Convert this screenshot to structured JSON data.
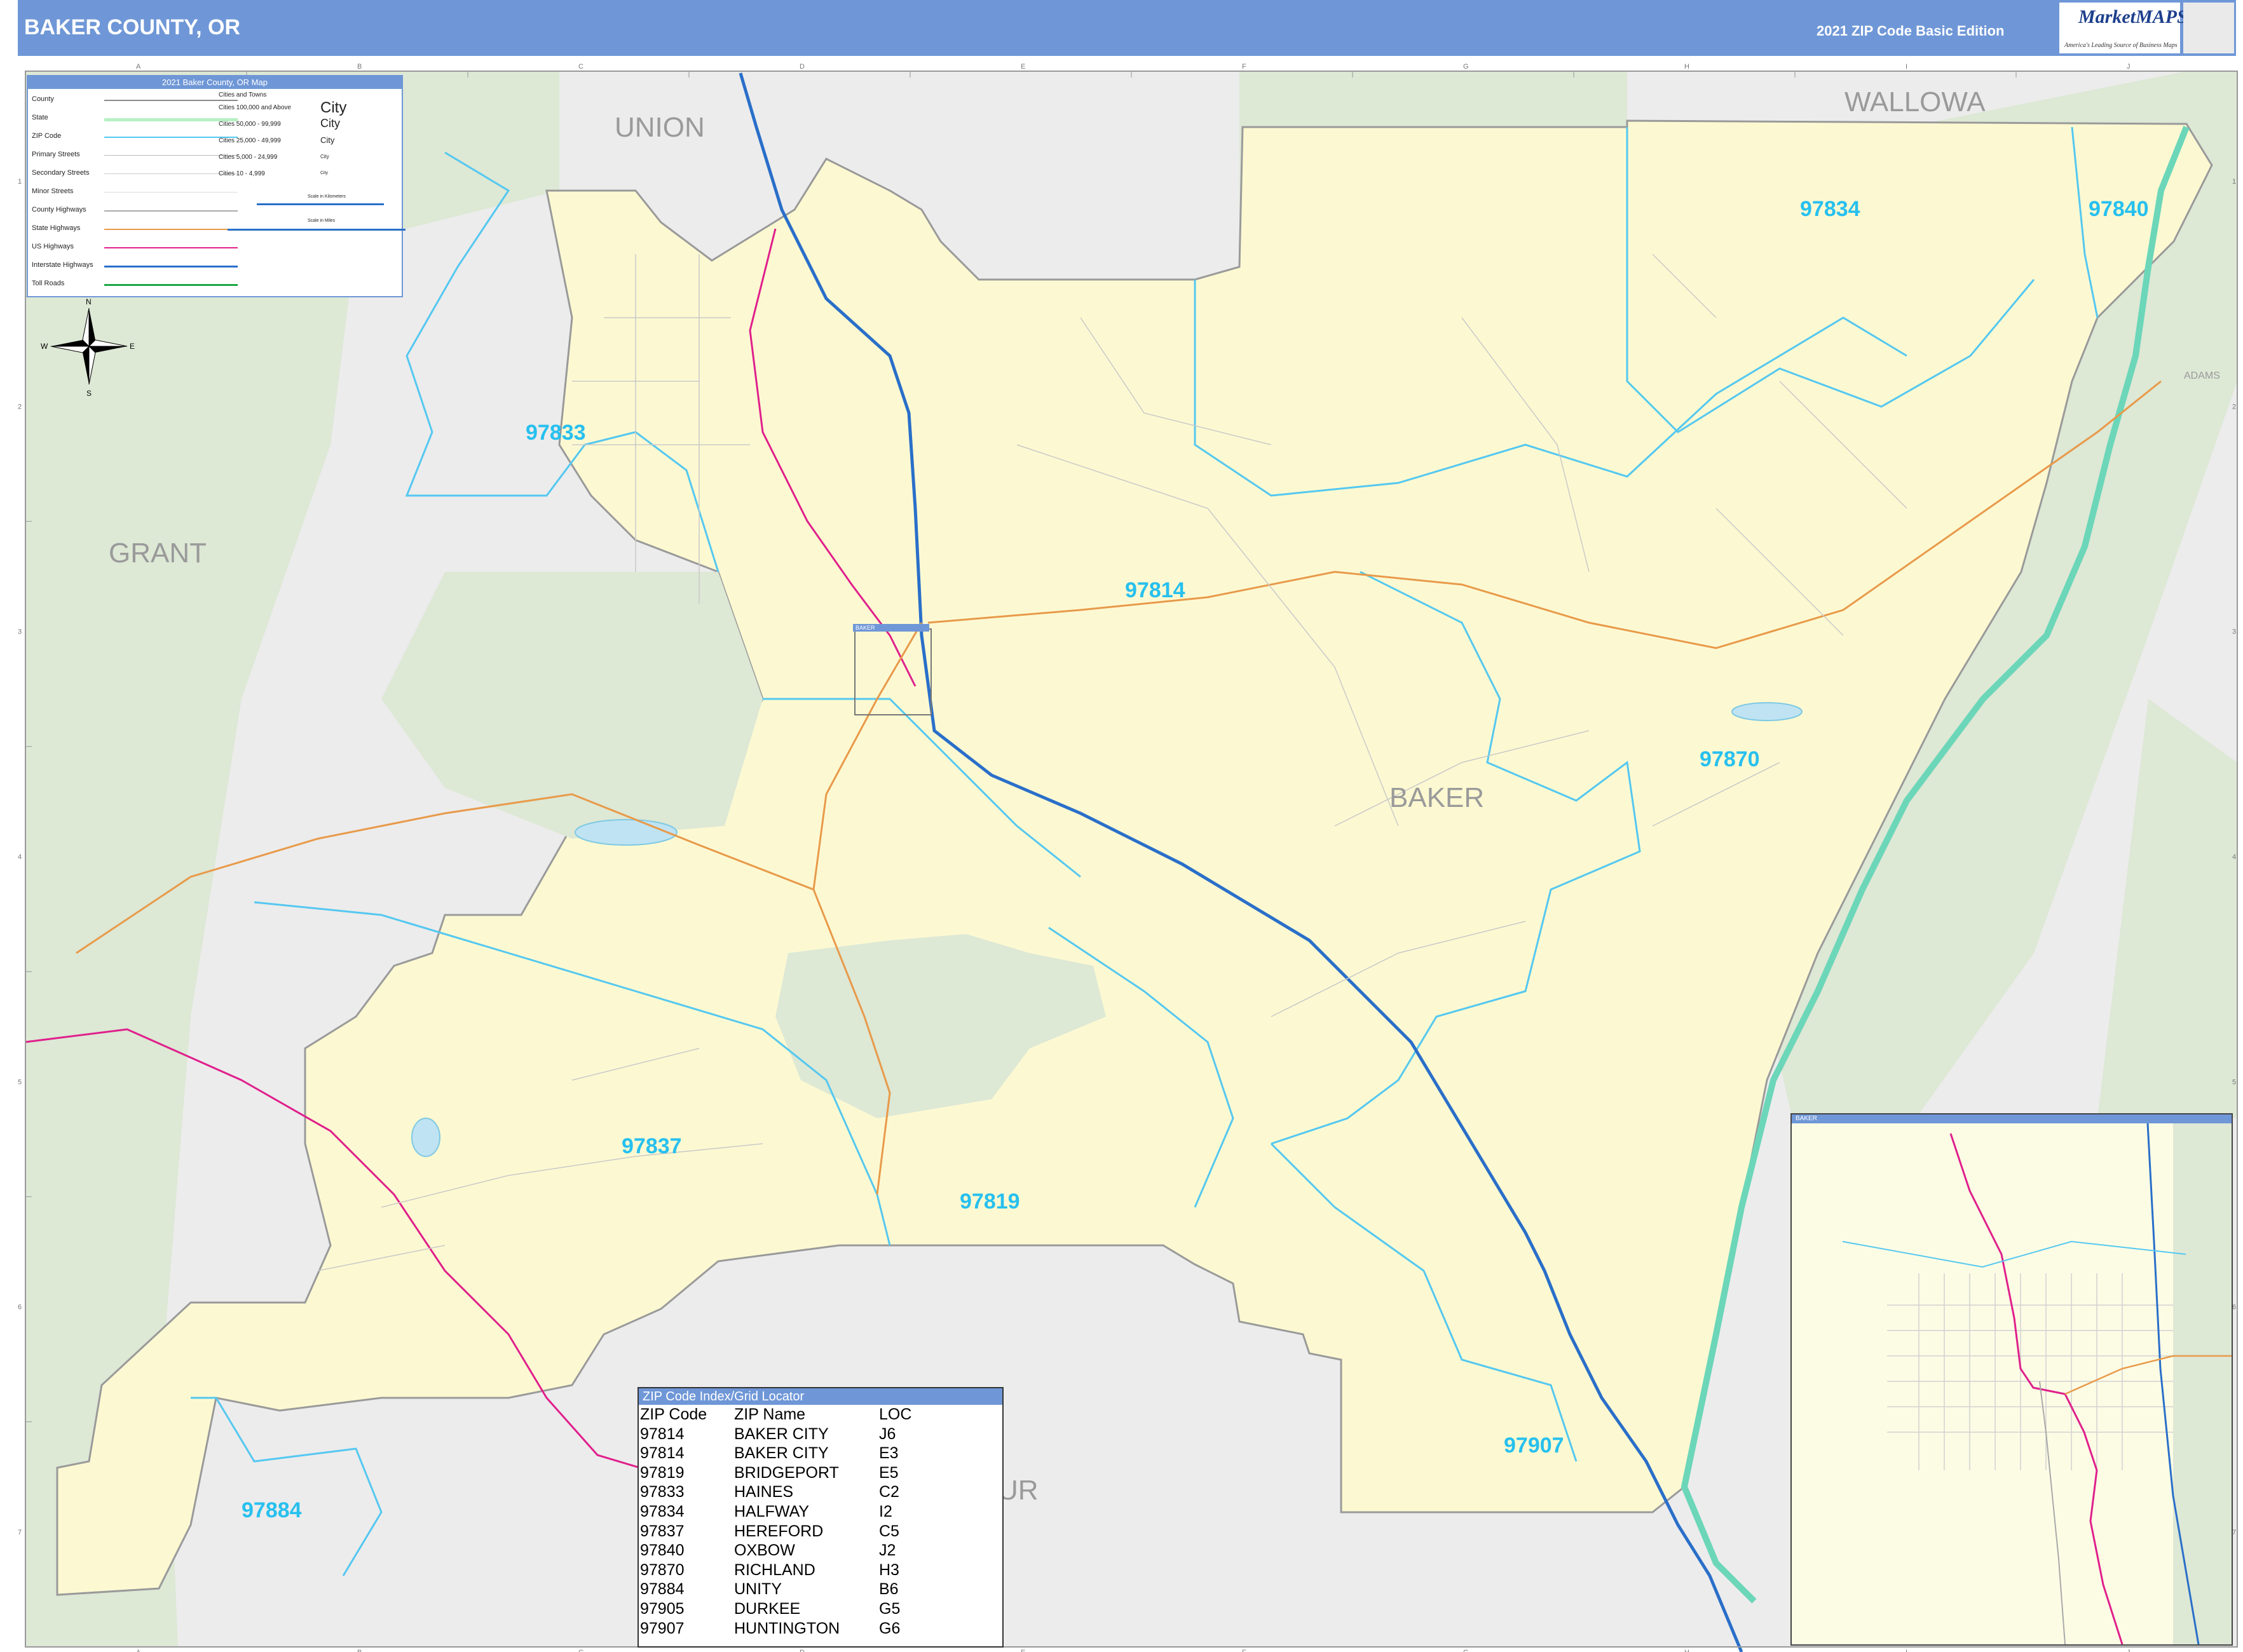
{
  "header": {
    "title": "BAKER COUNTY, OR",
    "edition": "2021 ZIP Code Basic Edition",
    "logo_brand": "MarketMAPS",
    "logo_tagline": "America's Leading Source of Business Maps"
  },
  "legend": {
    "title": "2021 Baker County, OR Map",
    "rows": [
      "County",
      "State",
      "ZIP Code",
      "Primary Streets",
      "Secondary Streets",
      "Minor Streets",
      "County Highways",
      "State Highways",
      "US Highways",
      "Interstate Highways",
      "Toll Roads"
    ],
    "cities_heading": "Cities and Towns",
    "city_classes": [
      "Cities 100,000 and Above",
      "Cities 50,000 - 99,999",
      "Cities 25,000 - 49,999",
      "Cities 5,000 - 24,999",
      "Cities 10 - 4,999"
    ],
    "city_samples": [
      "City",
      "City",
      "City",
      "City",
      "City"
    ],
    "scale_km": "Scale in Kilometers",
    "scale_mi": "Scale in Miles"
  },
  "compass": {
    "n": "N",
    "s": "S",
    "e": "E",
    "w": "W"
  },
  "neighbors": {
    "union": "UNION",
    "wallowa": "WALLOWA",
    "grant": "GRANT",
    "baker": "BAKER",
    "malheur_partial": "UR",
    "adams": "ADAMS"
  },
  "zip_labels": [
    {
      "zip": "97833"
    },
    {
      "zip": "97814"
    },
    {
      "zip": "97834"
    },
    {
      "zip": "97840"
    },
    {
      "zip": "97870"
    },
    {
      "zip": "97837"
    },
    {
      "zip": "97819"
    },
    {
      "zip": "97884"
    },
    {
      "zip": "97907"
    }
  ],
  "grid": {
    "columns": [
      "A",
      "B",
      "C",
      "D",
      "E",
      "F",
      "G",
      "H",
      "I",
      "J"
    ],
    "rows": [
      "1",
      "2",
      "3",
      "4",
      "5",
      "6",
      "7"
    ]
  },
  "index": {
    "title": "ZIP Code Index/Grid Locator",
    "headers": [
      "ZIP Code",
      "ZIP Name",
      "LOC"
    ],
    "rows": [
      [
        "97814",
        "BAKER CITY",
        "J6"
      ],
      [
        "97814",
        "BAKER CITY",
        "E3"
      ],
      [
        "97819",
        "BRIDGEPORT",
        "E5"
      ],
      [
        "97833",
        "HAINES",
        "C2"
      ],
      [
        "97834",
        "HALFWAY",
        "I2"
      ],
      [
        "97837",
        "HEREFORD",
        "C5"
      ],
      [
        "97840",
        "OXBOW",
        "J2"
      ],
      [
        "97870",
        "RICHLAND",
        "H3"
      ],
      [
        "97884",
        "UNITY",
        "B6"
      ],
      [
        "97905",
        "DURKEE",
        "G5"
      ],
      [
        "97907",
        "HUNTINGTON",
        "G6"
      ]
    ]
  },
  "inset": {
    "title": "BAKER",
    "small_label": "BAKER"
  },
  "colors": {
    "header": "#6f97d7",
    "county_fill": "#fcf9d2",
    "forest": "#dde8d5",
    "outside": "#ececec",
    "zip_line": "#55c8f0",
    "zip_label": "#27c0ee",
    "interstate": "#2a6fc9",
    "us_highway": "#e0208c",
    "state_highway": "#e89a4a",
    "water": "#bfe3f2"
  }
}
